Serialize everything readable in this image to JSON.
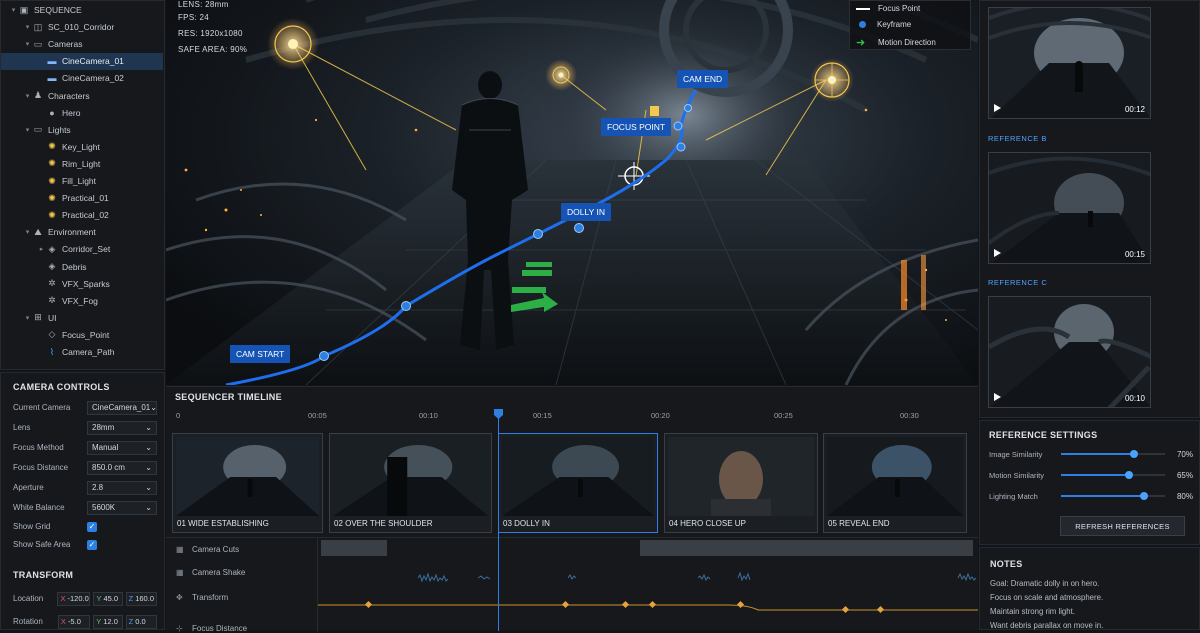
{
  "outliner": {
    "items": [
      {
        "label": "SEQUENCE",
        "depth": 0,
        "icon": "sequence-icon",
        "twisty": "▾"
      },
      {
        "label": "SC_010_Corridor",
        "depth": 1,
        "icon": "scene-icon",
        "twisty": "▾"
      },
      {
        "label": "Cameras",
        "depth": 1,
        "icon": "folder-icon",
        "twisty": "▾"
      },
      {
        "label": "CineCamera_01",
        "depth": 2,
        "icon": "camera-icon",
        "twisty": "",
        "selected": true
      },
      {
        "label": "CineCamera_02",
        "depth": 2,
        "icon": "camera-icon",
        "twisty": ""
      },
      {
        "label": "Characters",
        "depth": 1,
        "icon": "character-icon",
        "twisty": "▾"
      },
      {
        "label": "Hero",
        "depth": 2,
        "icon": "person-icon",
        "twisty": ""
      },
      {
        "label": "Lights",
        "depth": 1,
        "icon": "folder-icon",
        "twisty": "▾"
      },
      {
        "label": "Key_Light",
        "depth": 2,
        "icon": "light-icon",
        "twisty": ""
      },
      {
        "label": "Rim_Light",
        "depth": 2,
        "icon": "light-icon",
        "twisty": ""
      },
      {
        "label": "Fill_Light",
        "depth": 2,
        "icon": "light-icon",
        "twisty": ""
      },
      {
        "label": "Practical_01",
        "depth": 2,
        "icon": "light-icon",
        "twisty": ""
      },
      {
        "label": "Practical_02",
        "depth": 2,
        "icon": "light-icon",
        "twisty": ""
      },
      {
        "label": "Environment",
        "depth": 1,
        "icon": "environment-icon",
        "twisty": "▾"
      },
      {
        "label": "Corridor_Set",
        "depth": 2,
        "icon": "mesh-icon",
        "twisty": "▸"
      },
      {
        "label": "Debris",
        "depth": 2,
        "icon": "mesh-icon",
        "twisty": ""
      },
      {
        "label": "VFX_Sparks",
        "depth": 2,
        "icon": "vfx-icon",
        "twisty": ""
      },
      {
        "label": "VFX_Fog",
        "depth": 2,
        "icon": "vfx-icon",
        "twisty": ""
      },
      {
        "label": "UI",
        "depth": 1,
        "icon": "ui-icon",
        "twisty": "▾"
      },
      {
        "label": "Focus_Point",
        "depth": 2,
        "icon": "diamond-icon",
        "twisty": ""
      },
      {
        "label": "Camera_Path",
        "depth": 2,
        "icon": "path-icon",
        "twisty": ""
      }
    ]
  },
  "camera_controls": {
    "title": "CAMERA CONTROLS",
    "rows": [
      {
        "label": "Current Camera",
        "value": "CineCamera_01"
      },
      {
        "label": "Lens",
        "value": "28mm"
      },
      {
        "label": "Focus Method",
        "value": "Manual"
      },
      {
        "label": "Focus Distance",
        "value": "850.0 cm"
      },
      {
        "label": "Aperture",
        "value": "2.8"
      },
      {
        "label": "White Balance",
        "value": "5600K"
      }
    ],
    "show_grid_label": "Show Grid",
    "show_grid": true,
    "show_safe_label": "Show Safe Area",
    "show_safe": true
  },
  "transform": {
    "title": "TRANSFORM",
    "location_label": "Location",
    "location": {
      "x": "-120.0",
      "y": "45.0",
      "z": "160.0"
    },
    "rotation_label": "Rotation",
    "rotation": {
      "x": "-5.0",
      "y": "12.0",
      "z": "0.0"
    },
    "axis_x": "X",
    "axis_y": "Y",
    "axis_z": "Z"
  },
  "viewport": {
    "hud_lens": "LENS:  28mm",
    "hud_fps": "FPS:  24",
    "hud_res": "RES:  1920x1080",
    "hud_safe": "SAFE AREA:  90%",
    "labels": {
      "cam_start": "CAM START",
      "dolly_in": "DOLLY IN",
      "focus_point": "FOCUS POINT",
      "cam_end": "CAM END"
    },
    "legend": {
      "focus": "Focus Point",
      "keyframe": "Keyframe",
      "motion": "Motion Direction"
    }
  },
  "references": {
    "items": [
      {
        "title": "",
        "duration": "00:12"
      },
      {
        "title": "REFERENCE B",
        "duration": "00:15"
      },
      {
        "title": "REFERENCE C",
        "duration": "00:10"
      }
    ]
  },
  "reference_settings": {
    "title": "REFERENCE SETTINGS",
    "sliders": [
      {
        "label": "Image Similarity",
        "value": 70,
        "display": "70%"
      },
      {
        "label": "Motion Similarity",
        "value": 65,
        "display": "65%"
      },
      {
        "label": "Lighting Match",
        "value": 80,
        "display": "80%"
      }
    ],
    "refresh_label": "REFRESH REFERENCES"
  },
  "notes": {
    "title": "NOTES",
    "lines": [
      "Goal: Dramatic dolly in on hero.",
      "Focus on scale and atmosphere.",
      "Maintain strong rim light.",
      "Want debris parallax on move in."
    ]
  },
  "timeline": {
    "title": "SEQUENCER TIMELINE",
    "ticks": [
      "0",
      "00:05",
      "00:10",
      "00:15",
      "00:20",
      "00:25",
      "00:30"
    ],
    "shots": [
      {
        "label": "01  WIDE ESTABLISHING"
      },
      {
        "label": "02  OVER THE SHOULDER"
      },
      {
        "label": "03  DOLLY IN",
        "selected": true
      },
      {
        "label": "04  HERO CLOSE UP"
      },
      {
        "label": "05  REVEAL END"
      }
    ],
    "tracks": [
      "Camera Cuts",
      "Camera Shake",
      "Transform",
      "Focus Distance"
    ]
  },
  "colors": {
    "accent": "#2d7fe0",
    "label_bg": "#1553b5",
    "focus_gold": "#f2c94c",
    "motion_green": "#2fbf4a",
    "keyframe_gold": "#e6a23c"
  }
}
